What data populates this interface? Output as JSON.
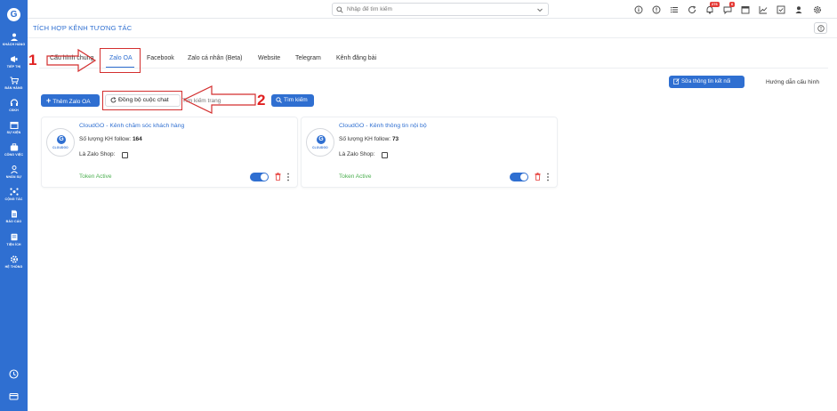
{
  "sidebar": {
    "logo": "G",
    "items": [
      {
        "label": "KHÁCH HÀNG",
        "icon": "users-icon"
      },
      {
        "label": "TIẾP THỊ",
        "icon": "megaphone-icon"
      },
      {
        "label": "BÁN HÀNG",
        "icon": "cart-icon"
      },
      {
        "label": "CSKH",
        "icon": "headset-icon"
      },
      {
        "label": "SỰ KIỆN",
        "icon": "calendar-icon"
      },
      {
        "label": "CÔNG VIỆC",
        "icon": "briefcase-icon"
      },
      {
        "label": "NHÂN SỰ",
        "icon": "person-icon"
      },
      {
        "label": "CỘNG TÁC",
        "icon": "network-icon"
      },
      {
        "label": "BÁO CÁO",
        "icon": "report-icon"
      },
      {
        "label": "TIỆN ÍCH",
        "icon": "utilities-icon"
      },
      {
        "label": "HỆ THỐNG",
        "icon": "gear-icon"
      }
    ],
    "bottom_icons": [
      "clock-icon",
      "card-icon"
    ]
  },
  "topbar": {
    "search_placeholder": "Nhập để tìm kiếm",
    "icons": [
      "info-icon",
      "help-circle-icon",
      "list-icon",
      "refresh-icon",
      "bell-icon",
      "chat-icon",
      "calendar-icon",
      "chart-icon",
      "checkbox-icon",
      "user-icon",
      "settings-icon"
    ],
    "bell_badge": "276",
    "chat_badge": "6"
  },
  "header": {
    "title": "TÍCH HỢP KÊNH TƯƠNG TÁC"
  },
  "tabs": [
    {
      "label": "Cấu hình chung",
      "active": false
    },
    {
      "label": "Zalo OA",
      "active": true
    },
    {
      "label": "Facebook",
      "active": false
    },
    {
      "label": "Zalo cá nhân (Beta)",
      "active": false
    },
    {
      "label": "Website",
      "active": false
    },
    {
      "label": "Telegram",
      "active": false
    },
    {
      "label": "Kênh đăng bài",
      "active": false
    }
  ],
  "actions": {
    "edit_connection": "Sửa thông tin kết nối",
    "guide": "Hướng dẫn cấu hình",
    "add_zalo_oa": "Thêm Zalo OA",
    "sync_chat": "Đồng bộ cuộc chat",
    "search_page_placeholder": "Tìm kiếm trang",
    "search_button": "Tìm kiếm"
  },
  "annotations": {
    "step1": "1",
    "step2": "2",
    "color": "#d32f2f"
  },
  "cards": [
    {
      "title": "CloudGO - Kênh chăm sóc khách hàng",
      "follow_label": "Số lượng KH follow:",
      "follow_count": "164",
      "shop_label": "Là Zalo Shop:",
      "token_status": "Token Active",
      "avatar_text": "CLOUDGO",
      "enabled": true
    },
    {
      "title": "CloudGO - Kênh thông tin nội bộ",
      "follow_label": "Số lượng KH follow:",
      "follow_count": "73",
      "shop_label": "Là Zalo Shop:",
      "token_status": "Token Active",
      "avatar_text": "CLOUDGO",
      "enabled": true
    }
  ],
  "colors": {
    "primary": "#2f6fd1",
    "token_active": "#4caf50",
    "danger": "#e53935"
  }
}
